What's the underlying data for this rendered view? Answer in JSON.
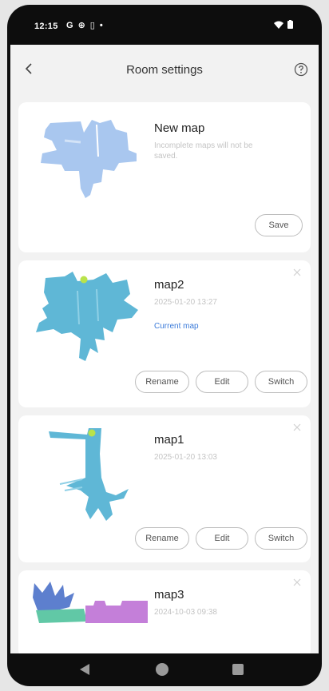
{
  "status_bar": {
    "time": "12:15",
    "left_icons": [
      "g-icon",
      "settings-icon",
      "battery-saver-icon",
      "dot-icon"
    ],
    "right_icons": [
      "wifi-icon",
      "battery-icon"
    ]
  },
  "header": {
    "title": "Room settings",
    "back_icon": "chevron-left-icon",
    "help_icon": "help-circle-icon"
  },
  "new_map": {
    "name": "New map",
    "note": "Incomplete maps will not be saved.",
    "save_label": "Save",
    "map_color": "#a9c7ef"
  },
  "maps": [
    {
      "name": "map2",
      "timestamp": "2025-01-20 13:27",
      "status": "Current map",
      "map_color": "#5fb7d6",
      "buttons": [
        "Rename",
        "Edit",
        "Switch"
      ]
    },
    {
      "name": "map1",
      "timestamp": "2025-01-20 13:03",
      "map_color": "#5fb7d6",
      "buttons": [
        "Rename",
        "Edit",
        "Switch"
      ]
    },
    {
      "name": "map3",
      "timestamp": "2024-10-03 09:38",
      "map_colors": [
        "#5d7fce",
        "#61c8a6",
        "#c47fd9"
      ]
    }
  ],
  "colors": {
    "accent": "#3a7ad9",
    "robot_marker": "#b9e34a",
    "background": "#f2f2f2",
    "card": "#ffffff"
  },
  "nav_bar": [
    "back-triangle-icon",
    "home-circle-icon",
    "recents-square-icon"
  ]
}
